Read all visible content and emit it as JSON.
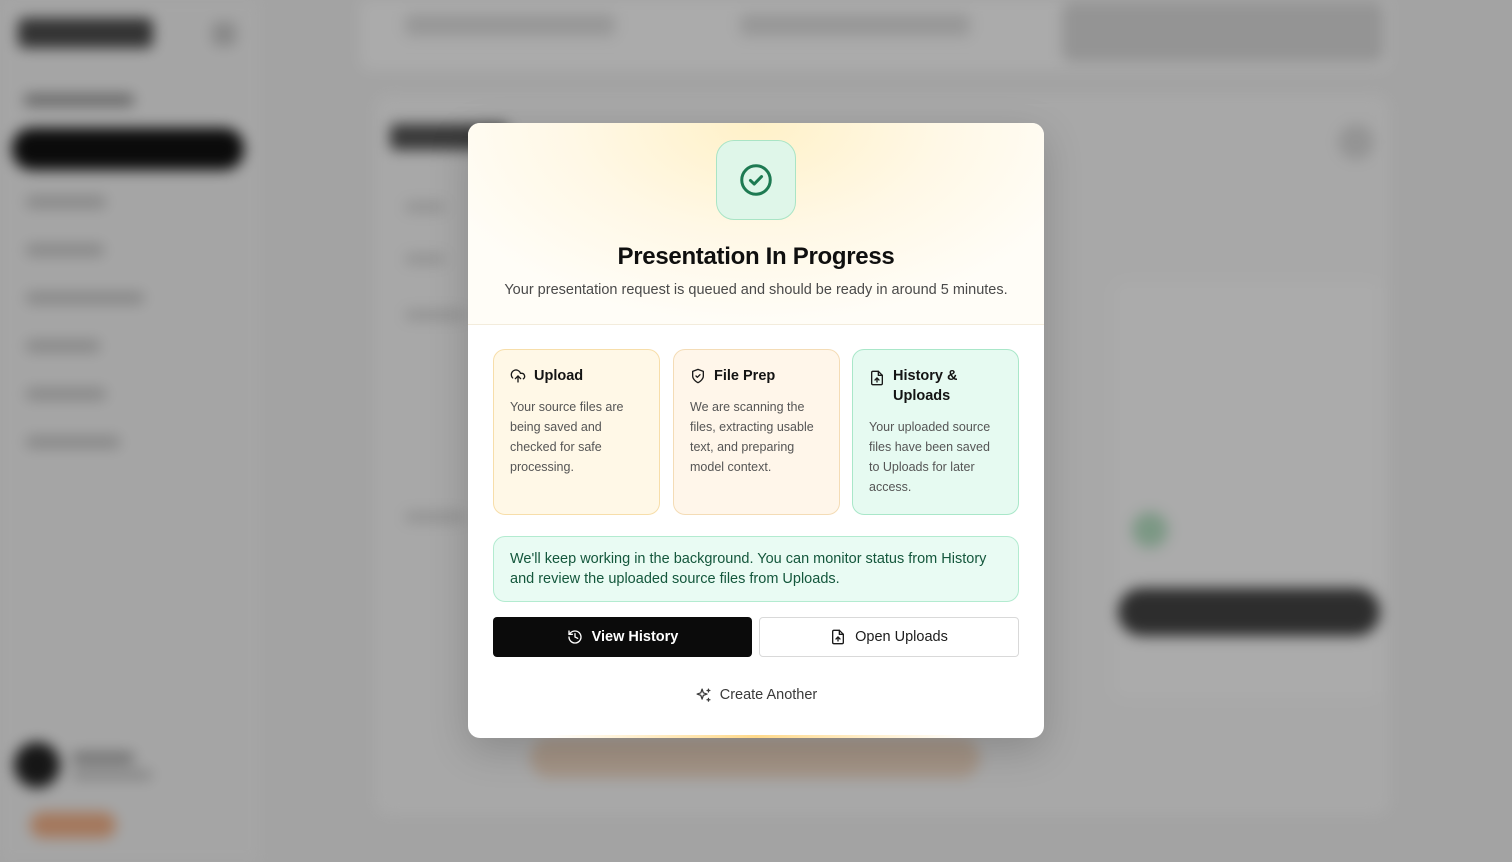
{
  "modal": {
    "title": "Presentation In Progress",
    "subtitle": "Your presentation request is queued and should be ready in around 5 minutes.",
    "hero_icon": "check-circle-icon",
    "cards": [
      {
        "title": "Upload",
        "icon": "cloud-upload-icon",
        "text": "Your source files are being saved and checked for safe processing."
      },
      {
        "title": "File Prep",
        "icon": "shield-check-icon",
        "text": "We are scanning the files, extracting usable text, and preparing model context."
      },
      {
        "title": "History & Uploads",
        "icon": "file-upload-icon",
        "text": "Your uploaded source files have been saved to Uploads for later access."
      }
    ],
    "notice": "We'll keep working in the background. You can monitor status from History and review the uploaded source files from Uploads.",
    "buttons": {
      "view_history": "View History",
      "open_uploads": "Open Uploads",
      "create_another": "Create Another"
    }
  },
  "colors": {
    "accent_green": "#1e7a52",
    "primary_button": "#0b0b0b",
    "upload_card_bg": "#fff8e7",
    "history_card_bg": "#e6faf1"
  }
}
